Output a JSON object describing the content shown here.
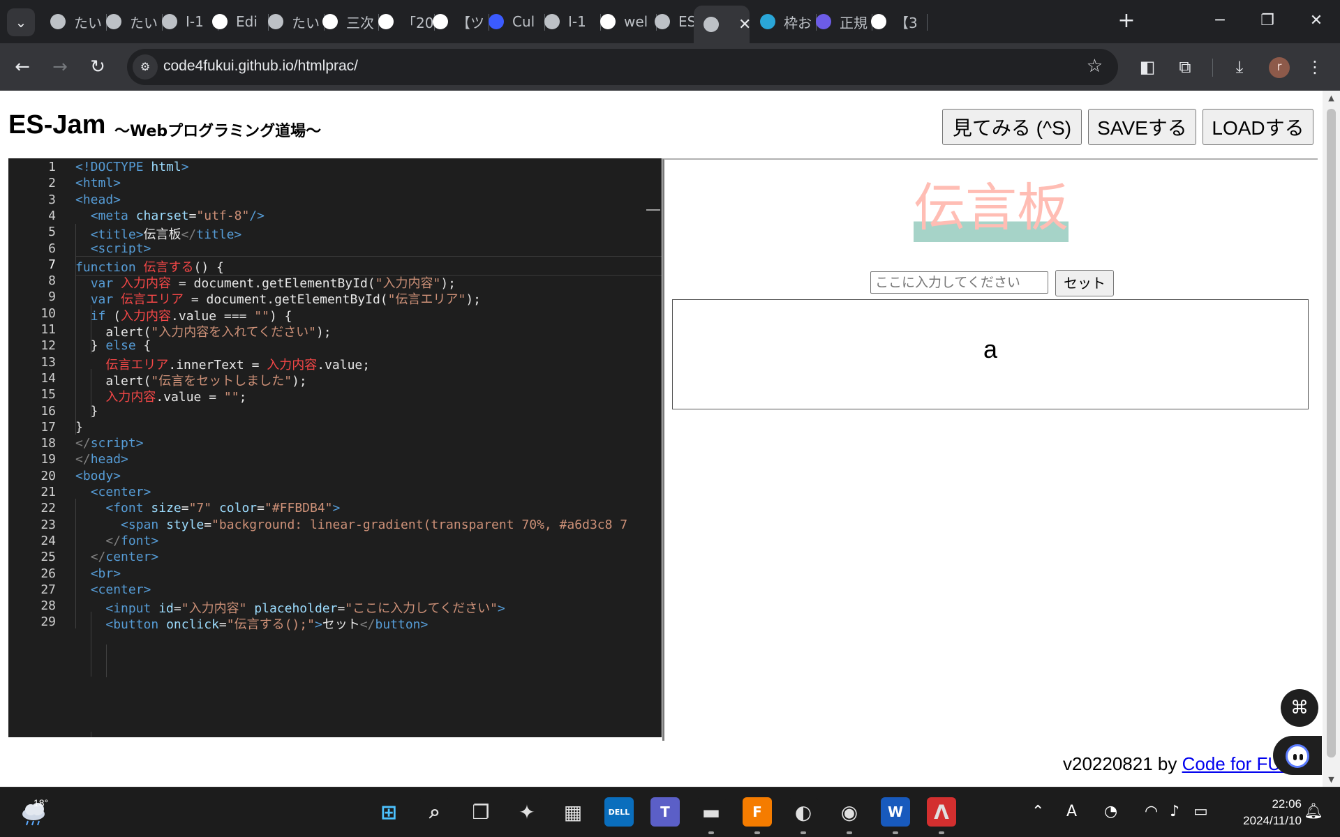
{
  "browser": {
    "tabs": [
      {
        "label": "たい",
        "icon": "globe-icon",
        "color": "#bdc1c6"
      },
      {
        "label": "たい",
        "icon": "globe-icon",
        "color": "#bdc1c6"
      },
      {
        "label": "I-1",
        "icon": "globe-icon",
        "color": "#bdc1c6"
      },
      {
        "label": "Edi",
        "icon": "github-icon",
        "color": "#ffffff"
      },
      {
        "label": "たい",
        "icon": "globe-icon",
        "color": "#bdc1c6"
      },
      {
        "label": "三次",
        "icon": "google-icon",
        "color": "#ffffff"
      },
      {
        "label": "「20",
        "icon": "contact-card-icon",
        "color": "#ffffff"
      },
      {
        "label": "【ツ",
        "icon": "wordpress-icon",
        "color": "#ffffff"
      },
      {
        "label": "Cul",
        "icon": "cube-icon",
        "color": "#3b5bff"
      },
      {
        "label": "I-1",
        "icon": "globe-icon",
        "color": "#bdc1c6"
      },
      {
        "label": "wel",
        "icon": "github-icon",
        "color": "#ffffff"
      },
      {
        "label": "ES-",
        "icon": "globe-icon",
        "color": "#bdc1c6"
      },
      {
        "label": "",
        "icon": "globe-icon",
        "color": "#bdc1c6",
        "active": true
      },
      {
        "label": "枠お",
        "icon": "flag-icon",
        "color": "#2aa6d8"
      },
      {
        "label": "正規",
        "icon": "dotted-circle-icon",
        "color": "#6c5ce7"
      },
      {
        "label": "【3",
        "icon": "contact-card-icon",
        "color": "#ffffff"
      }
    ],
    "url": "code4fukui.github.io/htmlprac/"
  },
  "page": {
    "title": "ES-Jam",
    "subtitle": "～Webプログラミング道場～",
    "buttons": {
      "run": "見てみる (^S)",
      "save": "SAVEする",
      "load": "LOADする"
    },
    "footer_version": "v20220821 by",
    "footer_link": "Code for FUKUI"
  },
  "editor": {
    "current_line": 7,
    "lines": [
      [
        [
          "tg",
          "<!DOCTYPE "
        ],
        [
          "at",
          "html"
        ],
        [
          "tg",
          ">"
        ]
      ],
      [
        [
          "tg",
          "<html>"
        ]
      ],
      [
        [
          "tg",
          "<head>"
        ]
      ],
      [
        [
          "tx",
          "  "
        ],
        [
          "tg",
          "<meta "
        ],
        [
          "at",
          "charset"
        ],
        [
          "tx",
          "="
        ],
        [
          "st",
          "\"utf-8\""
        ],
        [
          "tg",
          "/>"
        ]
      ],
      [
        [
          "tx",
          "  "
        ],
        [
          "tg",
          "<title>"
        ],
        [
          "tx",
          "伝言板"
        ],
        [
          "dim",
          "</"
        ],
        [
          "tg",
          "title>"
        ]
      ],
      [
        [
          "tx",
          "  "
        ],
        [
          "tg",
          "<script>"
        ]
      ],
      [
        [
          "kw",
          "function "
        ],
        [
          "id",
          "伝言する"
        ],
        [
          "tx",
          "() {"
        ]
      ],
      [
        [
          "tx",
          "  "
        ],
        [
          "kw",
          "var "
        ],
        [
          "id",
          "入力内容"
        ],
        [
          "tx",
          " = document.getElementById("
        ],
        [
          "st",
          "\"入力内容\""
        ],
        [
          "tx",
          ");"
        ]
      ],
      [
        [
          "tx",
          "  "
        ],
        [
          "kw",
          "var "
        ],
        [
          "id",
          "伝言エリア"
        ],
        [
          "tx",
          " = document.getElementById("
        ],
        [
          "st",
          "\"伝言エリア\""
        ],
        [
          "tx",
          ");"
        ]
      ],
      [
        [
          "tx",
          "  "
        ],
        [
          "kw",
          "if "
        ],
        [
          "tx",
          "("
        ],
        [
          "id",
          "入力内容"
        ],
        [
          "tx",
          ".value === "
        ],
        [
          "st",
          "\"\""
        ],
        [
          "tx",
          ") {"
        ]
      ],
      [
        [
          "tx",
          "    alert("
        ],
        [
          "st",
          "\"入力内容を入れてください\""
        ],
        [
          "tx",
          ");"
        ]
      ],
      [
        [
          "tx",
          "  } "
        ],
        [
          "kw",
          "else "
        ],
        [
          "tx",
          "{"
        ]
      ],
      [
        [
          "tx",
          "    "
        ],
        [
          "id",
          "伝言エリア"
        ],
        [
          "tx",
          ".innerText = "
        ],
        [
          "id",
          "入力内容"
        ],
        [
          "tx",
          ".value;"
        ]
      ],
      [
        [
          "tx",
          "    alert("
        ],
        [
          "st",
          "\"伝言をセットしました\""
        ],
        [
          "tx",
          ");"
        ]
      ],
      [
        [
          "tx",
          "    "
        ],
        [
          "id",
          "入力内容"
        ],
        [
          "tx",
          ".value = "
        ],
        [
          "st",
          "\"\""
        ],
        [
          "tx",
          ";"
        ]
      ],
      [
        [
          "tx",
          "  }"
        ]
      ],
      [
        [
          "tx",
          "}"
        ]
      ],
      [
        [
          "dim",
          "</"
        ],
        [
          "tg",
          "script>"
        ]
      ],
      [
        [
          "dim",
          "</"
        ],
        [
          "tg",
          "head>"
        ]
      ],
      [
        [
          "tg",
          "<body>"
        ]
      ],
      [
        [
          "tx",
          "  "
        ],
        [
          "tg",
          "<center>"
        ]
      ],
      [
        [
          "tx",
          "    "
        ],
        [
          "tg",
          "<font "
        ],
        [
          "at",
          "size"
        ],
        [
          "tx",
          "="
        ],
        [
          "st",
          "\"7\" "
        ],
        [
          "at",
          "color"
        ],
        [
          "tx",
          "="
        ],
        [
          "st",
          "\"#FFBDB4\""
        ],
        [
          "tg",
          ">"
        ]
      ],
      [
        [
          "tx",
          "      "
        ],
        [
          "tg",
          "<span "
        ],
        [
          "at",
          "style"
        ],
        [
          "tx",
          "="
        ],
        [
          "st",
          "\"background: linear-gradient(transparent 70%, #a6d3c8 7"
        ]
      ],
      [
        [
          "tx",
          "    "
        ],
        [
          "dim",
          "</"
        ],
        [
          "tg",
          "font>"
        ]
      ],
      [
        [
          "tx",
          "  "
        ],
        [
          "dim",
          "</"
        ],
        [
          "tg",
          "center>"
        ]
      ],
      [
        [
          "tx",
          "  "
        ],
        [
          "tg",
          "<br>"
        ]
      ],
      [
        [
          "tx",
          "  "
        ],
        [
          "tg",
          "<center>"
        ]
      ],
      [
        [
          "tx",
          "    "
        ],
        [
          "tg",
          "<input "
        ],
        [
          "at",
          "id"
        ],
        [
          "tx",
          "="
        ],
        [
          "st",
          "\"入力内容\" "
        ],
        [
          "at",
          "placeholder"
        ],
        [
          "tx",
          "="
        ],
        [
          "st",
          "\"ここに入力してください\""
        ],
        [
          "tg",
          ">"
        ]
      ],
      [
        [
          "tx",
          "    "
        ],
        [
          "tg",
          "<button "
        ],
        [
          "at",
          "onclick"
        ],
        [
          "tx",
          "="
        ],
        [
          "st",
          "\"伝言する();\""
        ],
        [
          "tg",
          ">"
        ],
        [
          "tx",
          "セット"
        ],
        [
          "dim",
          "</"
        ],
        [
          "tg",
          "button>"
        ]
      ]
    ]
  },
  "preview": {
    "heading": "伝言板",
    "input_placeholder": "ここに入力してください",
    "button": "セット",
    "message": "a"
  },
  "taskbar": {
    "temperature": "18°",
    "time": "22:06",
    "date": "2024/11/10",
    "apps": [
      {
        "name": "start-icon",
        "label": "",
        "bg": "#1c1c1c"
      },
      {
        "name": "search-icon",
        "label": "",
        "bg": "#1c1c1c"
      },
      {
        "name": "task-view-icon",
        "label": "",
        "bg": "#1c1c1c"
      },
      {
        "name": "copilot-icon",
        "label": "",
        "bg": "#1c1c1c"
      },
      {
        "name": "store-icon",
        "label": "",
        "bg": "#1c1c1c"
      },
      {
        "name": "dell-icon",
        "label": "DELL",
        "bg": "#0a6ebd"
      },
      {
        "name": "teams-icon",
        "label": "T",
        "bg": "#5b5fc7"
      },
      {
        "name": "file-explorer-icon",
        "label": "",
        "bg": "#1c1c1c"
      },
      {
        "name": "fusion-icon",
        "label": "F",
        "bg": "#f57c00"
      },
      {
        "name": "edge-icon",
        "label": "",
        "bg": "#1c1c1c"
      },
      {
        "name": "chrome-icon",
        "label": "",
        "bg": "#1c1c1c"
      },
      {
        "name": "word-icon",
        "label": "W",
        "bg": "#185abd"
      },
      {
        "name": "acrobat-icon",
        "label": "",
        "bg": "#d32f2f"
      }
    ]
  },
  "colors": {
    "heading": "#FFBDB4",
    "highlight": "#a6d3c8"
  }
}
